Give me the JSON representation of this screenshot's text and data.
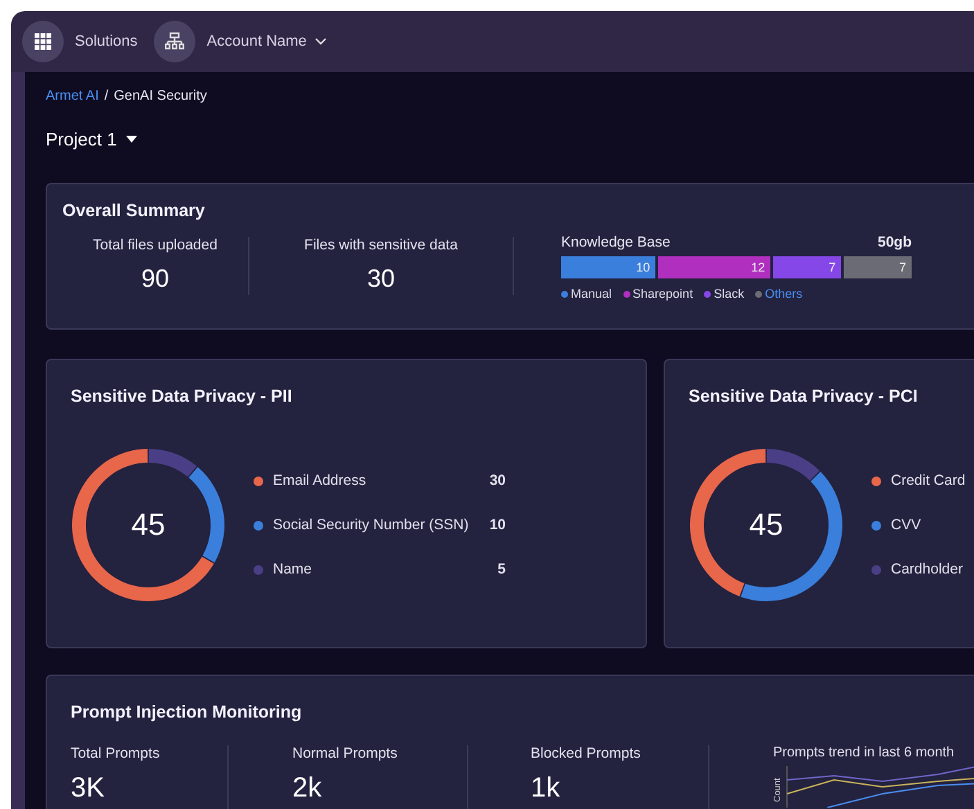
{
  "topbar": {
    "solutions": "Solutions",
    "account": "Account Name"
  },
  "breadcrumb": {
    "link": "Armet AI",
    "separator": "/",
    "current": "GenAI Security"
  },
  "project": "Project 1",
  "summary": {
    "title": "Overall Summary",
    "stats": [
      {
        "label": "Total files uploaded",
        "value": "90"
      },
      {
        "label": "Files with sensitive data",
        "value": "30"
      }
    ],
    "knowledge_base": {
      "title": "Knowledge Base",
      "size": "50gb",
      "bar": [
        {
          "value": "10",
          "color": "#3b7fdd"
        },
        {
          "value": "12",
          "color": "#b02fbf"
        },
        {
          "value": "7",
          "color": "#8547e8"
        },
        {
          "value": "7",
          "color": "#6b6b75"
        }
      ],
      "legend": [
        {
          "label": "Manual",
          "color": "#3b7fdd",
          "link": false
        },
        {
          "label": "Sharepoint",
          "color": "#b02fbf",
          "link": false
        },
        {
          "label": "Slack",
          "color": "#8547e8",
          "link": false
        },
        {
          "label": "Others",
          "color": "#6b6b75",
          "link": true
        }
      ]
    }
  },
  "pii": {
    "title": "Sensitive Data Privacy - PII",
    "total": "45",
    "items": [
      {
        "label": "Email Address",
        "value": "30",
        "color": "#e8664a"
      },
      {
        "label": "Social Security Number (SSN)",
        "value": "10",
        "color": "#3b7fdd"
      },
      {
        "label": "Name",
        "value": "5",
        "color": "#4a3f86"
      }
    ]
  },
  "pci": {
    "title": "Sensitive Data Privacy - PCI",
    "total": "45",
    "items": [
      {
        "label": "Credit Card",
        "color": "#e8664a"
      },
      {
        "label": "CVV",
        "color": "#3b7fdd"
      },
      {
        "label": "Cardholder",
        "color": "#4a3f86"
      }
    ]
  },
  "prompts": {
    "title": "Prompt Injection Monitoring",
    "stats": [
      {
        "label": "Total Prompts",
        "value": "3K"
      },
      {
        "label": "Normal Prompts",
        "value": "2k"
      },
      {
        "label": "Blocked Prompts",
        "value": "1k"
      }
    ],
    "trend": {
      "title": "Prompts trend in last 6 month",
      "axis_label": "Count"
    }
  }
}
